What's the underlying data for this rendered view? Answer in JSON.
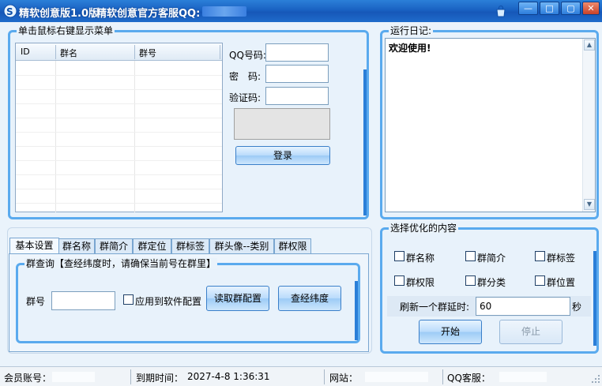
{
  "titlebar": {
    "app_title": "精软创意版1.0版",
    "service_title": "精软创意官方客服QQ:",
    "colors": {
      "bar": "#1a62c2",
      "accent": "#5aaaee"
    }
  },
  "account_panel": {
    "title": "单击鼠标右键显示菜单",
    "columns": [
      "ID",
      "群名",
      "群号"
    ],
    "qq_label": "QQ号码:",
    "password_label": "密　码:",
    "captcha_label": "验证码:",
    "qq_value": "",
    "password_value": "",
    "captcha_value": "",
    "login_button": "登录"
  },
  "log_panel": {
    "title": "运行日记:",
    "content": "欢迎使用!"
  },
  "tabs": {
    "items": [
      "基本设置",
      "群名称",
      "群简介",
      "群定位",
      "群标签",
      "群头像--类别",
      "群权限"
    ],
    "active": "基本设置"
  },
  "basic": {
    "group_title": "群查询【查经纬度时，请确保当前号在群里】",
    "group_no_label": "群号",
    "group_no_value": "",
    "apply_label": "应用到软件配置",
    "apply_checked": false,
    "read_button": "读取群配置",
    "check_button": "查经纬度"
  },
  "optimize": {
    "title": "选择优化的内容",
    "options": [
      {
        "label": "群名称",
        "checked": false
      },
      {
        "label": "群简介",
        "checked": false
      },
      {
        "label": "群标签",
        "checked": false
      },
      {
        "label": "群权限",
        "checked": false
      },
      {
        "label": "群分类",
        "checked": false
      },
      {
        "label": "群位置",
        "checked": false
      }
    ],
    "delay_label": "刷新一个群延时:",
    "delay_value": "60",
    "delay_unit": "秒",
    "start_button": "开始",
    "stop_button": "停止"
  },
  "statusbar": {
    "member_label": "会员账号：",
    "expire_label": "到期时间：",
    "expire_value": "2027-4-8 1:36:31",
    "website_label": "网站：",
    "qq_service_label": "QQ客服："
  }
}
